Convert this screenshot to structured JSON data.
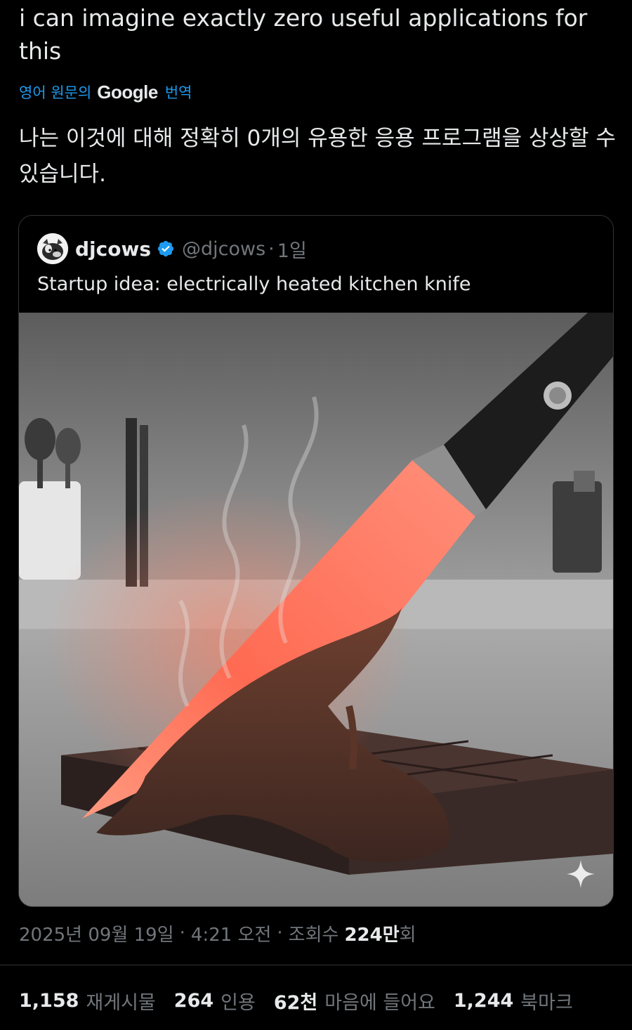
{
  "post": {
    "text": "i can imagine exactly zero useful applications for this",
    "translate_prefix": "영어 원문의",
    "translate_brand": "Google",
    "translate_suffix": "번역",
    "translated_text": "나는 이것에 대해 정확히 0개의 유용한 응용 프로그램을 상상할 수 있습니다."
  },
  "quote": {
    "name": "djcows",
    "handle": "@djcows",
    "separator": "·",
    "time": "1일",
    "text": "Startup idea: electrically heated kitchen knife"
  },
  "meta": {
    "date": "2025년 09월 19일",
    "sep1": "·",
    "time": "4:21 오전",
    "sep2": "·",
    "views_label": "조회수",
    "views_value": "224만",
    "views_suffix": "회"
  },
  "stats": [
    {
      "num": "1,158",
      "label": "재게시물"
    },
    {
      "num": "264",
      "label": "인용"
    },
    {
      "num": "62천",
      "label": "마음에 들어요"
    },
    {
      "num": "1,244",
      "label": "북마크"
    }
  ],
  "colors": {
    "background": "#000000",
    "text": "#e7e9ea",
    "muted": "#71767b",
    "link": "#1d9bf0",
    "border": "#2f3336"
  }
}
